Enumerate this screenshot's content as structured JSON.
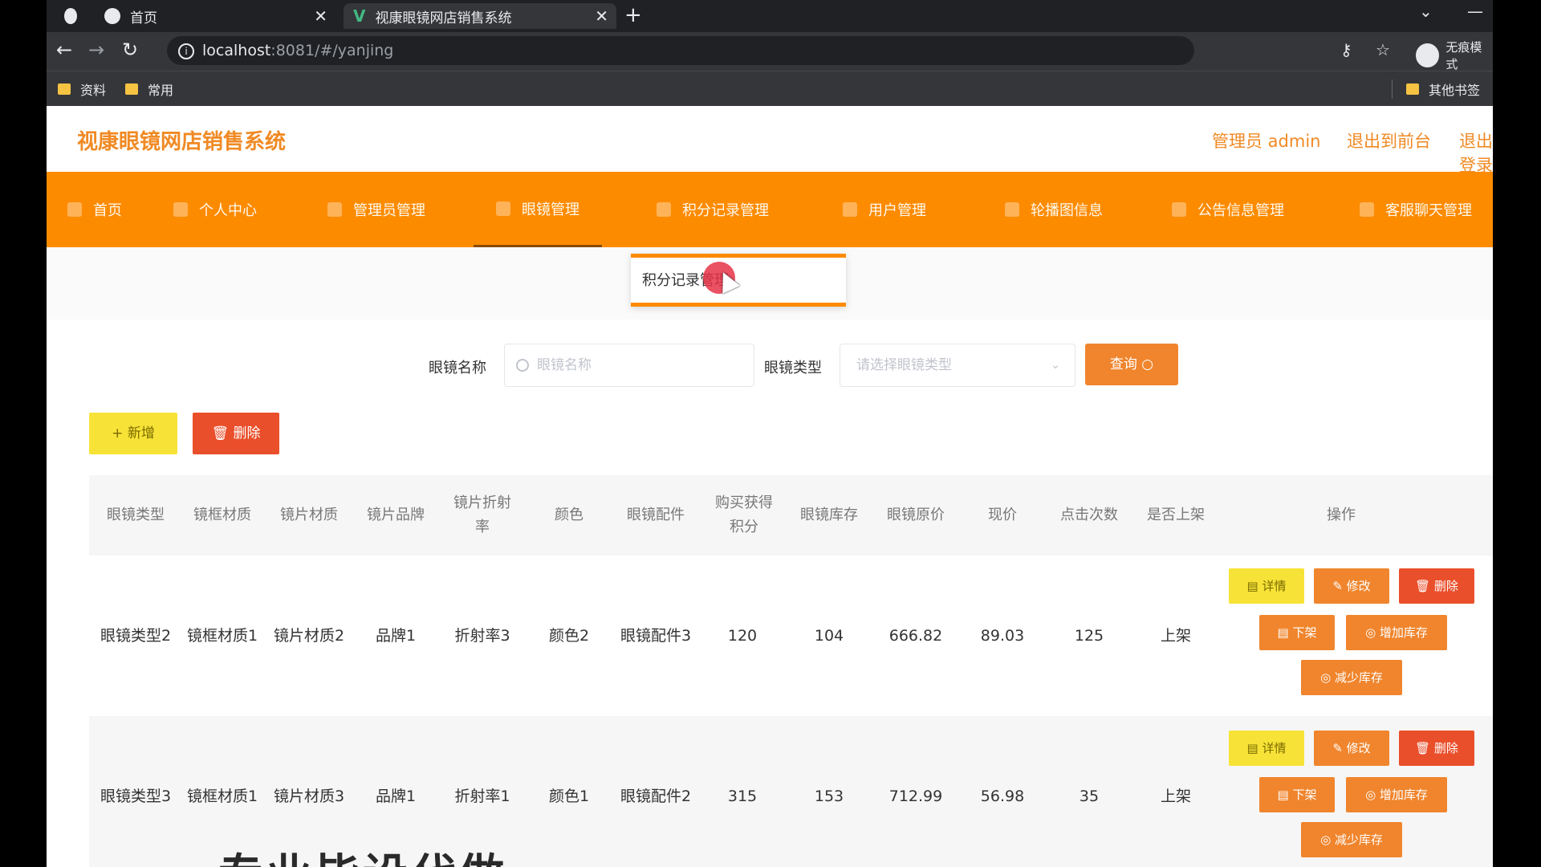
{
  "browser": {
    "tabs": [
      {
        "title": "首页"
      },
      {
        "title": "视康眼镜网店销售系统"
      }
    ],
    "url_host": "localhost",
    "url_rest": ":8081/#/yanjing",
    "bookmarks": [
      "资料",
      "常用"
    ],
    "other_bookmarks": "其他书签",
    "profile_name": "无痕模式"
  },
  "app": {
    "title": "视康眼镜网店销售系统",
    "admin_label": "管理员 admin",
    "front_link": "退出到前台",
    "logout_link": "退出登录"
  },
  "menu": [
    {
      "label": "首页"
    },
    {
      "label": "个人中心"
    },
    {
      "label": "管理员管理"
    },
    {
      "label": "眼镜管理"
    },
    {
      "label": "积分记录管理"
    },
    {
      "label": "用户管理"
    },
    {
      "label": "轮播图信息"
    },
    {
      "label": "公告信息管理"
    },
    {
      "label": "客服聊天管理"
    }
  ],
  "dropdown": {
    "item": "积分记录管理"
  },
  "search": {
    "name_label": "眼镜名称",
    "name_placeholder": "眼镜名称",
    "type_label": "眼镜类型",
    "type_placeholder": "请选择眼镜类型",
    "query_button": "查询"
  },
  "actions": {
    "add": "+ 新增",
    "delete": "删除"
  },
  "table": {
    "headers": [
      "眼镜类型",
      "镜框材质",
      "镜片材质",
      "镜片品牌",
      "镜片折射率",
      "颜色",
      "眼镜配件",
      "购买获得积分",
      "眼镜库存",
      "眼镜原价",
      "现价",
      "点击次数",
      "是否上架",
      "操作"
    ],
    "rows": [
      {
        "type": "眼镜类型2",
        "frame": "镜框材质1",
        "lens": "镜片材质2",
        "brand": "品牌1",
        "refraction": "折射率3",
        "color": "颜色2",
        "accessory": "眼镜配件3",
        "points": "120",
        "stock": "104",
        "original_price": "666.82",
        "price": "89.03",
        "clicks": "125",
        "on_shelf": "上架"
      },
      {
        "type": "眼镜类型3",
        "frame": "镜框材质1",
        "lens": "镜片材质3",
        "brand": "品牌1",
        "refraction": "折射率1",
        "color": "颜色1",
        "accessory": "眼镜配件2",
        "points": "315",
        "stock": "153",
        "original_price": "712.99",
        "price": "56.98",
        "clicks": "35",
        "on_shelf": "上架"
      }
    ],
    "op_labels": {
      "detail": "详情",
      "edit": "修改",
      "delete": "删除",
      "off_shelf": "下架",
      "add_stock": "增加库存",
      "reduce_stock": "减少库存"
    }
  },
  "overlay_text": "专业毕设代做"
}
